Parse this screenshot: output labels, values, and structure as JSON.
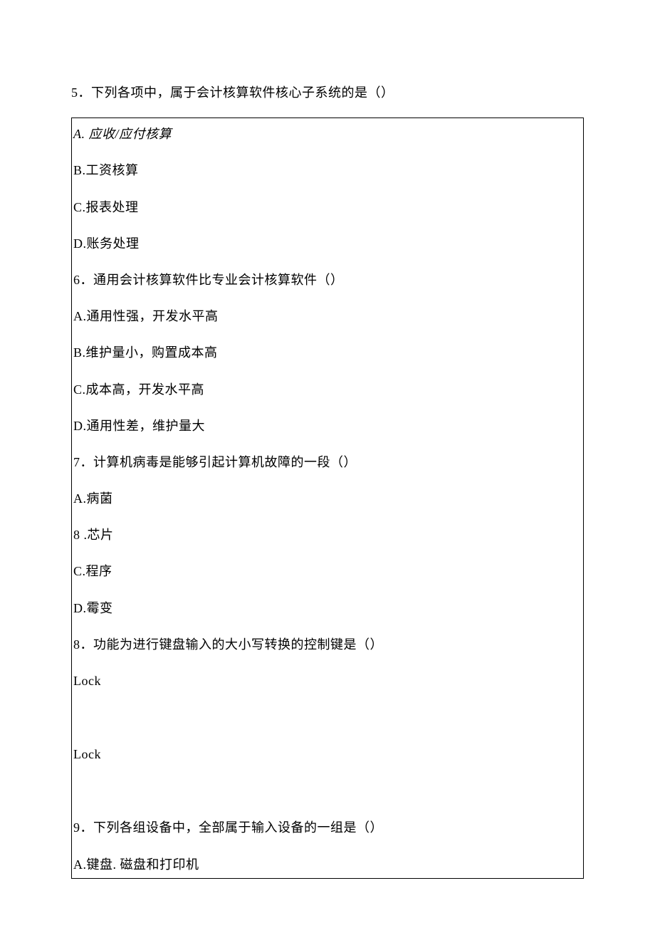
{
  "q5": {
    "stem": "5．下列各项中，属于会计核算软件核心子系统的是（）",
    "a": "A. 应收/应付核算",
    "b": "B.工资核算",
    "c": "C.报表处理",
    "d": "D.账务处理"
  },
  "q6": {
    "stem": "6．通用会计核算软件比专业会计核算软件（）",
    "a": "A.通用性强，开发水平高",
    "b": "B.维护量小，购置成本高",
    "c": "C.成本高，开发水平高",
    "d": "D.通用性差，维护量大"
  },
  "q7": {
    "stem": "7．计算机病毒是能够引起计算机故障的一段（）",
    "a": "A.病菌",
    "b": "8 .芯片",
    "c": "C.程序",
    "d": "D.霉变"
  },
  "q8": {
    "stem": "8．功能为进行键盘输入的大小写转换的控制键是（）",
    "a": "Lock",
    "b": "Lock"
  },
  "q9": {
    "stem": "9．下列各组设备中，全部属于输入设备的一组是（）",
    "a": "A.键盘. 磁盘和打印机"
  }
}
